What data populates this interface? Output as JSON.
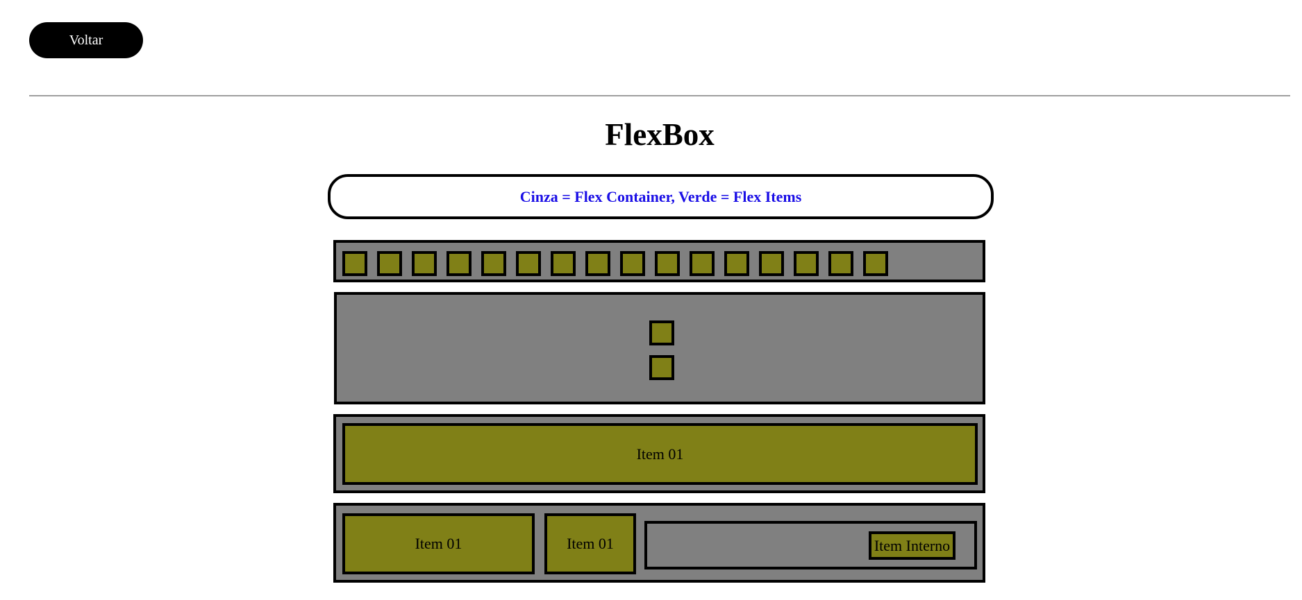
{
  "header": {
    "back_label": "Voltar"
  },
  "page_title": "FlexBox",
  "legend": {
    "text": "Cinza = Flex Container, Verde = Flex Items"
  },
  "colors": {
    "container": "#808080",
    "item": "#808017",
    "legend_text": "#1a0ee6"
  },
  "container_1": {
    "item_count": 16
  },
  "container_2": {
    "item_count": 2
  },
  "container_3": {
    "item_label": "Item 01"
  },
  "container_4": {
    "item_a_label": "Item 01",
    "item_b_label": "Item 01",
    "inner_item_label": "Item Interno"
  }
}
